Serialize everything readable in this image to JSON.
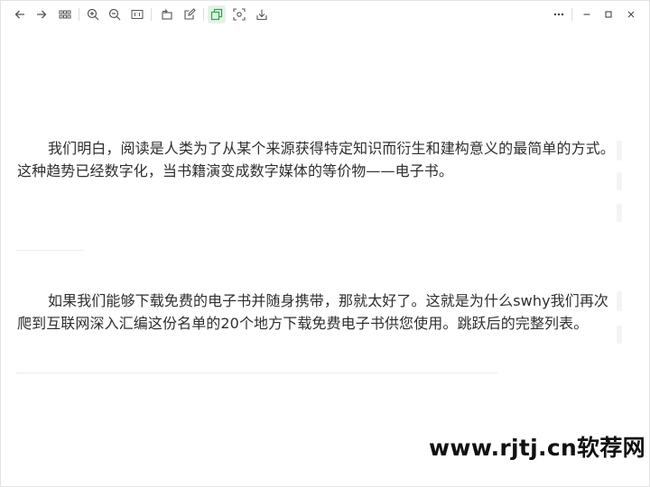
{
  "toolbar": {
    "left_icons": [
      "back-arrow-icon",
      "forward-arrow-icon",
      "grid-view-icon",
      "zoom-in-icon",
      "zoom-out-icon",
      "actual-size-icon",
      "rotate-icon",
      "edit-icon",
      "crop-icon",
      "screenshot-scan-icon",
      "save-icon"
    ],
    "window_controls": [
      "more-icon",
      "minimize-icon",
      "maximize-icon",
      "close-icon"
    ],
    "accent_color": "#2aa84a"
  },
  "document": {
    "paragraph1": "我们明白，阅读是人类为了从某个来源获得特定知识而衍生和建构意义的最简单的方式。这种趋势已经数字化，当书籍演变成数字媒体的等价物——电子书。",
    "paragraph2": "如果我们能够下载免费的电子书并随身携带，那就太好了。这就是为什么swhy我们再次爬到互联网深入汇编这份名单的20个地方下载免费电子书供您使用。跳跃后的完整列表。"
  },
  "watermark": {
    "text": "www.rjtj.cn软荐网"
  }
}
